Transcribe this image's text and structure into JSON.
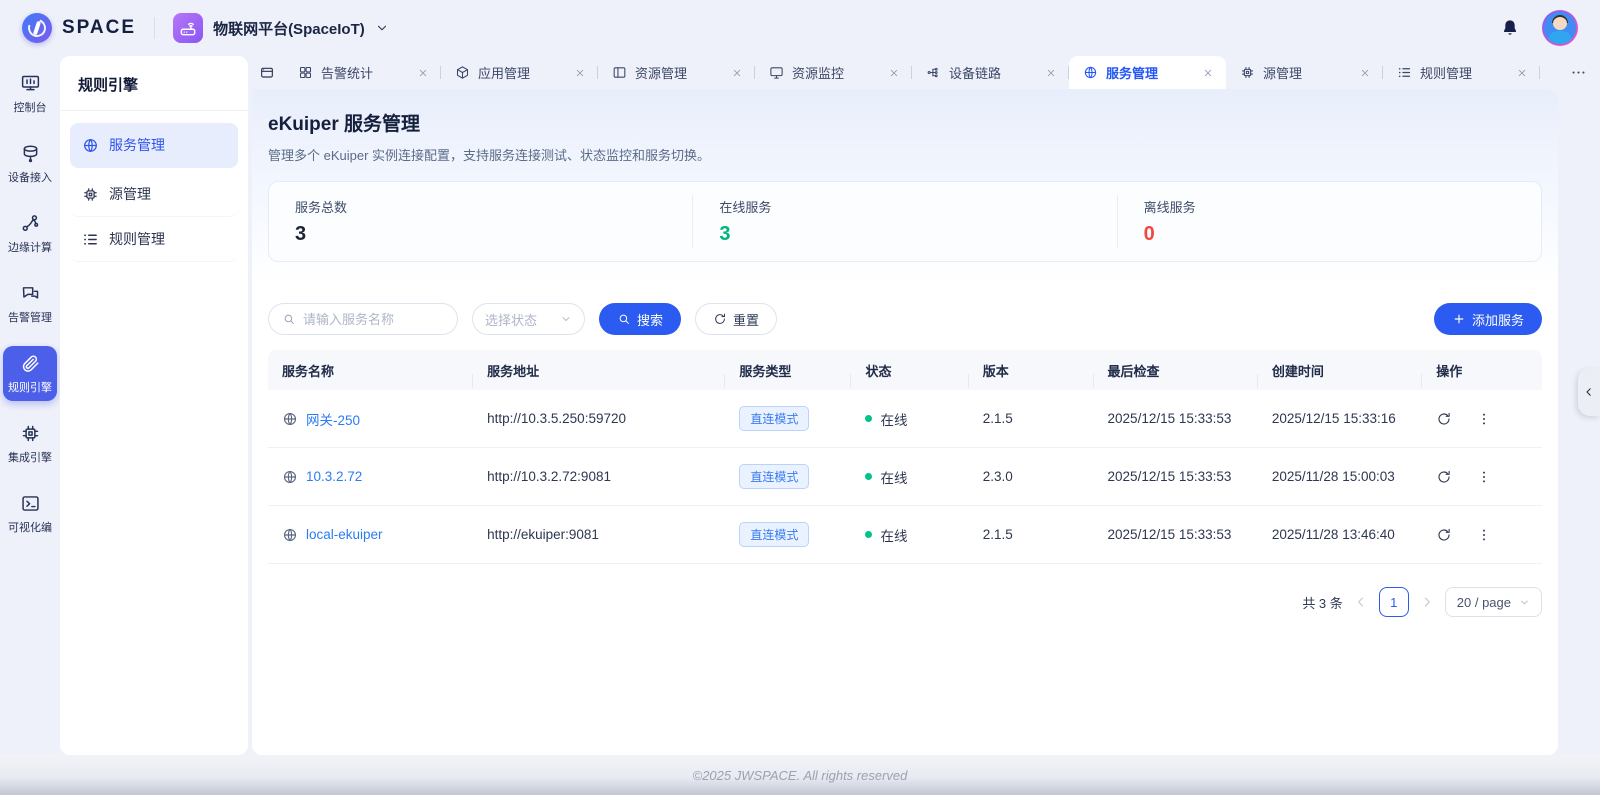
{
  "colors": {
    "accent": "#2b5bf0",
    "link": "#2b7cf4",
    "online_green": "#00c389",
    "offline_red": "#f0483e"
  },
  "topbar": {
    "brand": "SPACE",
    "workspace": "物联网平台(SpaceIoT)"
  },
  "rail": {
    "items": [
      {
        "key": "console",
        "label": "控制台",
        "icon": "board-icon",
        "active": false
      },
      {
        "key": "device-access",
        "label": "设备接入",
        "icon": "device-icon",
        "active": false
      },
      {
        "key": "edge-computing",
        "label": "边缘计算",
        "icon": "edge-icon",
        "active": false
      },
      {
        "key": "alarm-management",
        "label": "告警管理",
        "icon": "alarm-icon",
        "active": false
      },
      {
        "key": "rule-engine",
        "label": "规则引擎",
        "icon": "clip-icon",
        "active": true
      },
      {
        "key": "integration-engine",
        "label": "集成引擎",
        "icon": "chip-icon",
        "active": false
      },
      {
        "key": "visual-editor",
        "label": "可视化编",
        "icon": "terminal-icon",
        "active": false
      }
    ]
  },
  "sidebar": {
    "title": "规则引擎",
    "items": [
      {
        "key": "service-management",
        "label": "服务管理",
        "icon": "globe-icon",
        "active": true
      },
      {
        "key": "source-management",
        "label": "源管理",
        "icon": "chip-icon",
        "active": false
      },
      {
        "key": "rule-management",
        "label": "规则管理",
        "icon": "list-icon",
        "active": false
      }
    ]
  },
  "tabs": {
    "items": [
      {
        "key": "alarm-stats",
        "label": "告警统计",
        "icon": "grid-icon",
        "active": false
      },
      {
        "key": "app-management",
        "label": "应用管理",
        "icon": "cube-icon",
        "active": false
      },
      {
        "key": "resource-management",
        "label": "资源管理",
        "icon": "layout-icon",
        "active": false
      },
      {
        "key": "resource-monitor",
        "label": "资源监控",
        "icon": "monitor-icon",
        "active": false
      },
      {
        "key": "device-link",
        "label": "设备链路",
        "icon": "linknodes-icon",
        "active": false
      },
      {
        "key": "service-management",
        "label": "服务管理",
        "icon": "globe-icon",
        "active": true
      },
      {
        "key": "source-management",
        "label": "源管理",
        "icon": "chip-icon",
        "active": false
      },
      {
        "key": "rule-management",
        "label": "规则管理",
        "icon": "list-icon",
        "active": false
      }
    ]
  },
  "page": {
    "title": "eKuiper 服务管理",
    "subtitle": "管理多个 eKuiper 实例连接配置，支持服务连接测试、状态监控和服务切换。"
  },
  "stats": [
    {
      "label": "服务总数",
      "value": "3",
      "color": "#1c2434"
    },
    {
      "label": "在线服务",
      "value": "3",
      "color": "#00b57a"
    },
    {
      "label": "离线服务",
      "value": "0",
      "color": "#f0483e"
    }
  ],
  "filters": {
    "search_placeholder": "请输入服务名称",
    "status_placeholder": "选择状态",
    "search_button": "搜索",
    "reset_button": "重置",
    "add_button": "添加服务"
  },
  "table": {
    "columns": [
      "服务名称",
      "服务地址",
      "服务类型",
      "状态",
      "版本",
      "最后检查",
      "创建时间",
      "操作"
    ],
    "rows": [
      {
        "name": "网关-250",
        "address": "http://10.3.5.250:59720",
        "type": "直连模式",
        "status": "在线",
        "version": "2.1.5",
        "last_check": "2025/12/15 15:33:53",
        "created": "2025/12/15 15:33:16"
      },
      {
        "name": "10.3.2.72",
        "address": "http://10.3.2.72:9081",
        "type": "直连模式",
        "status": "在线",
        "version": "2.3.0",
        "last_check": "2025/12/15 15:33:53",
        "created": "2025/11/28 15:00:03"
      },
      {
        "name": "local-ekuiper",
        "address": "http://ekuiper:9081",
        "type": "直连模式",
        "status": "在线",
        "version": "2.1.5",
        "last_check": "2025/12/15 15:33:53",
        "created": "2025/11/28 13:46:40"
      }
    ]
  },
  "pagination": {
    "total": "共 3 条",
    "page": "1",
    "size": "20 / page"
  },
  "footer": {
    "copyright": "©2025 JWSPACE. All rights reserved"
  }
}
